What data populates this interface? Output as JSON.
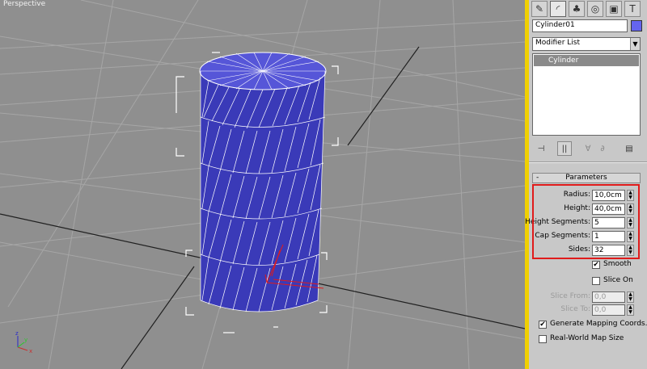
{
  "viewport": {
    "label": "Perspective"
  },
  "command_panel": {
    "tabs": [
      {
        "icon": "create-icon",
        "glyph": "✎"
      },
      {
        "icon": "modify-icon",
        "glyph": "◜"
      },
      {
        "icon": "hierarchy-icon",
        "glyph": "♣"
      },
      {
        "icon": "motion-icon",
        "glyph": "◎"
      },
      {
        "icon": "display-icon",
        "glyph": "▣"
      },
      {
        "icon": "utilities-icon",
        "glyph": "T"
      }
    ],
    "object_name": "Cylinder01",
    "object_color": "#6464ee",
    "modifier_list": "Modifier List",
    "stack_items": [
      "Cylinder"
    ],
    "stack_buttons": [
      {
        "icon": "pin-stack-icon",
        "glyph": "⊣"
      },
      {
        "icon": "show-end-result-icon",
        "glyph": "||"
      },
      {
        "icon": "make-unique-icon",
        "glyph": "∀"
      },
      {
        "icon": "remove-modifier-icon",
        "glyph": "∂"
      },
      {
        "icon": "configure-modifier-sets-icon",
        "glyph": "▤"
      }
    ]
  },
  "parameters": {
    "title": "Parameters",
    "collapse": "-",
    "radius": {
      "label": "Radius:",
      "value": "10,0cm"
    },
    "height": {
      "label": "Height:",
      "value": "40,0cm"
    },
    "height_segments": {
      "label": "Height Segments:",
      "value": "5"
    },
    "cap_segments": {
      "label": "Cap Segments:",
      "value": "1"
    },
    "sides": {
      "label": "Sides:",
      "value": "32"
    },
    "smooth": {
      "label": "Smooth",
      "checked": true
    },
    "slice_on": {
      "label": "Slice On",
      "checked": false
    },
    "slice_from": {
      "label": "Slice From:",
      "value": "0,0"
    },
    "slice_to": {
      "label": "Slice To:",
      "value": "0,0"
    },
    "generate_mapping": {
      "label": "Generate Mapping Coords.",
      "checked": true
    },
    "real_world": {
      "label": "Real-World Map Size",
      "checked": false
    }
  },
  "colors": {
    "highlight": "#e01b1b",
    "active_border": "#f0d000",
    "mesh": "#3a3ab8"
  }
}
